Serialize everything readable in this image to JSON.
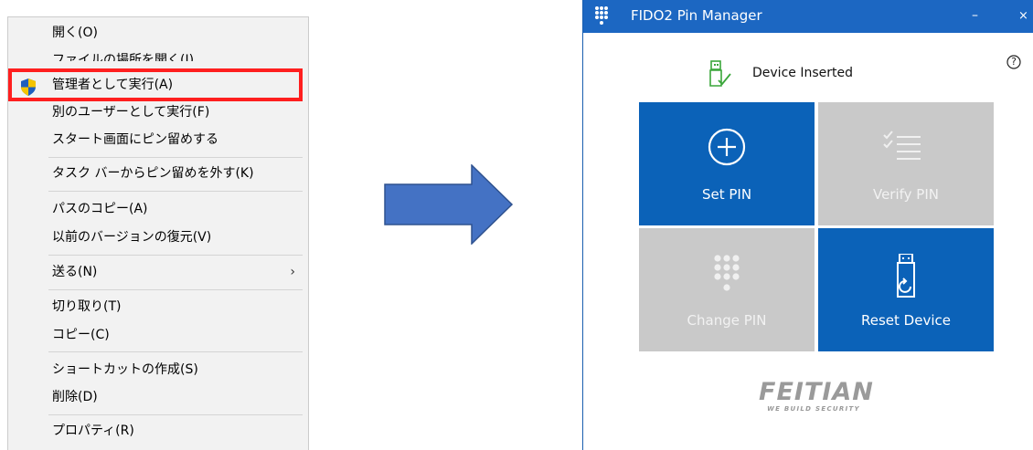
{
  "context_menu": {
    "items": [
      {
        "label": "開く(O)",
        "underline": "O"
      },
      {
        "label": "ファイルの場所を開く(I)"
      },
      {
        "label": "管理者として実行(A)",
        "icon": "uac-shield-icon",
        "highlighted": true
      },
      {
        "label": "別のユーザーとして実行(F)"
      },
      {
        "label": "スタート画面にピン留めする"
      },
      {
        "label": "タスク バーからピン留めを外す(K)"
      },
      {
        "label": "パスのコピー(A)"
      },
      {
        "label": "以前のバージョンの復元(V)"
      },
      {
        "label": "送る(N)",
        "submenu": "›"
      },
      {
        "label": "切り取り(T)"
      },
      {
        "label": "コピー(C)"
      },
      {
        "label": "ショートカットの作成(S)"
      },
      {
        "label": "削除(D)"
      },
      {
        "label": "プロパティ(R)"
      }
    ]
  },
  "window": {
    "title": "FIDO2 Pin Manager",
    "minimize_glyph": "–",
    "close_glyph": "×",
    "help_glyph": "?",
    "device_status": "Device Inserted",
    "tiles": [
      {
        "label": "Set PIN",
        "icon": "plus-circle-icon",
        "enabled": true
      },
      {
        "label": "Verify PIN",
        "icon": "checklist-icon",
        "enabled": false
      },
      {
        "label": "Change PIN",
        "icon": "keypad-icon",
        "enabled": false
      },
      {
        "label": "Reset Device",
        "icon": "usb-reset-icon",
        "enabled": true
      }
    ],
    "logo": {
      "main": "FEITIAN",
      "tagline": "WE BUILD SECURITY"
    }
  },
  "colors": {
    "accent": "#0b62b8",
    "titlebar": "#1c67c2",
    "disabled": "#c9c9c9",
    "highlight_border": "#ff1f1f",
    "arrow": "#4472c4"
  }
}
